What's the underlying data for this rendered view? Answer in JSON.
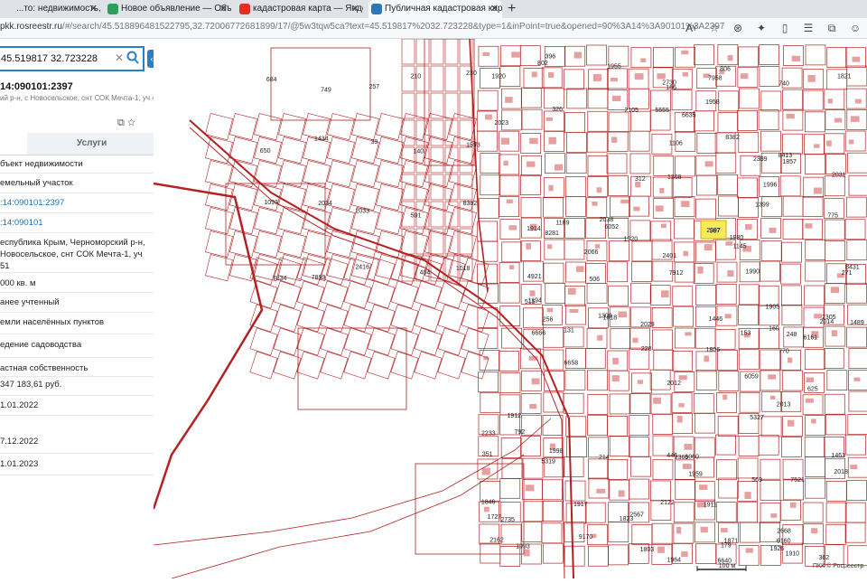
{
  "browser": {
    "tabs": [
      {
        "title": "...то: недвижимость, транспорт",
        "active": false
      },
      {
        "title": "Новое объявление — Объявлен",
        "active": false
      },
      {
        "title": "кадастровая карта — Яндекс: на",
        "active": false
      },
      {
        "title": "Публичная кадастровая карта",
        "active": true
      }
    ],
    "address_host": "pkk.rosreestr.ru",
    "address_path": "/#/search/45.518896481522795,32.72006772681899/17/@5w3tqw5ca?text=45.519817%2032.723228&type=1&inPoint=true&opened=90%3A14%3A90101%3A2397"
  },
  "panel": {
    "search_value": "45.519817 32.723228",
    "cad_number": "14:090101:2397",
    "address_short": "ий р-н, с Новосельское, снт СОК Мечта-1, уч 451",
    "tab_services": "Услуги",
    "rows": [
      {
        "text": "бъект недвижимости",
        "link": false
      },
      {
        "text": "емельный участок",
        "link": false
      },
      {
        "text": ":14:090101:2397",
        "link": true
      },
      {
        "text": ":14:090101",
        "link": true
      },
      {
        "text": "еспублика Крым, Черноморский р-н,",
        "link": false
      },
      {
        "text": "Новосельское, снт СОК Мечта-1, уч",
        "link": false
      },
      {
        "text": "51",
        "link": false
      },
      {
        "text": "000 кв. м",
        "link": false
      },
      {
        "text": "анее учтенный",
        "link": false
      },
      {
        "text": "емли населённых пунктов",
        "link": false
      },
      {
        "text": "едение садоводства",
        "link": false
      },
      {
        "text": "астная собственность",
        "link": false
      },
      {
        "text": "347 183,61 руб.",
        "link": false
      },
      {
        "text": "1.01.2022",
        "link": false
      },
      {
        "text": "7.12.2022",
        "link": false
      },
      {
        "text": "1.01.2023",
        "link": false
      }
    ]
  },
  "map": {
    "labels": [
      "684",
      "749",
      "257",
      "210",
      "230",
      "650",
      "1434",
      "39",
      "140",
      "1593",
      "1093",
      "2034",
      "2033",
      "591",
      "8382",
      "7834",
      "7899",
      "2416",
      "404",
      "1018",
      "153",
      "1926",
      "625",
      "160",
      "1818",
      "2031",
      "1446",
      "1905",
      "1980",
      "1959",
      "312",
      "1920",
      "1463",
      "1958",
      "228",
      "792",
      "1145",
      "1914",
      "1955",
      "271",
      "1910",
      "2162",
      "770",
      "7521",
      "2122",
      "1106",
      "1368",
      "2023",
      "2029",
      "256",
      "2397",
      "1920",
      "362",
      "802",
      "2668",
      "1917",
      "740",
      "8382",
      "248",
      "1803",
      "1821",
      "775",
      "2105",
      "1727",
      "2305",
      "351",
      "326",
      "515",
      "567",
      "6160",
      "6161",
      "6635",
      "5319",
      "166",
      "4921",
      "179",
      "6052",
      "6059",
      "6060",
      "5327",
      "7958",
      "6658",
      "1489",
      "396",
      "2233",
      "5555",
      "569",
      "131",
      "446",
      "1911",
      "1189",
      "2567",
      "1194",
      "506",
      "2365",
      "1871",
      "1857",
      "1998",
      "2012",
      "1993",
      "2399",
      "1846",
      "2730",
      "2401",
      "1964",
      "214",
      "2013",
      "2038",
      "2014",
      "8431",
      "8413",
      "1806",
      "1823",
      "9170",
      "1399",
      "1309",
      "2735",
      "6640",
      "6666",
      "7912",
      "806",
      "8281",
      "2018",
      "1912",
      "1996",
      "1990",
      "2066"
    ],
    "selected_parcel": "2397",
    "scale_label": "100 м",
    "copyright": "ПКК © Росреестр"
  }
}
